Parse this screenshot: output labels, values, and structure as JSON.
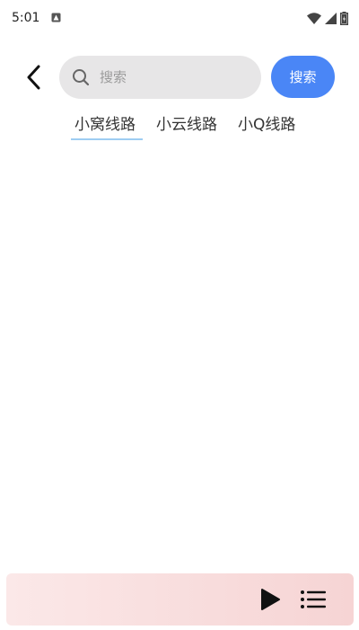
{
  "status_bar": {
    "time": "5:01"
  },
  "header": {
    "back_icon": "chevron-left-icon",
    "search": {
      "placeholder": "搜索",
      "value": "",
      "icon": "search-icon"
    },
    "search_button_label": "搜索"
  },
  "tabs": [
    {
      "label": "小窝线路",
      "active": true
    },
    {
      "label": "小云线路",
      "active": false
    },
    {
      "label": "小Q线路",
      "active": false
    }
  ],
  "player_bar": {
    "play_icon": "play-icon",
    "playlist_icon": "playlist-icon"
  },
  "colors": {
    "accent": "#4a86f6",
    "tab_indicator": "#9ecdf2",
    "search_bg": "#e7e6e7",
    "player_bg_start": "#fbe8e8",
    "player_bg_end": "#f6d4d4"
  }
}
